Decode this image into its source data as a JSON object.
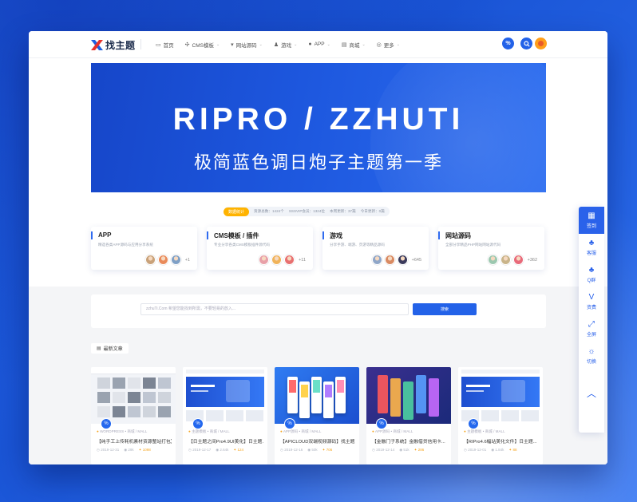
{
  "header": {
    "logo_text": "找主题",
    "nav": [
      {
        "icon": "monitor-icon",
        "glyph": "▭",
        "label": "首页",
        "caret": false
      },
      {
        "icon": "grid-icon",
        "glyph": "✣",
        "label": "CMS模板",
        "caret": true
      },
      {
        "icon": "vue-icon",
        "glyph": "▾",
        "label": "网站源码",
        "caret": true
      },
      {
        "icon": "game-icon",
        "glyph": "♟",
        "label": "游戏",
        "caret": true
      },
      {
        "icon": "apple-icon",
        "glyph": "●",
        "label": "APP",
        "caret": true
      },
      {
        "icon": "shop-icon",
        "glyph": "▤",
        "label": "商城",
        "caret": true
      },
      {
        "icon": "more-icon",
        "glyph": "◎",
        "label": "更多",
        "caret": true
      }
    ]
  },
  "banner": {
    "title": "RIPRO / ZZHUTI",
    "subtitle": "极简蓝色调日炮子主题第一季"
  },
  "stats": {
    "badge": "数据统计",
    "items": [
      "资源总数：1424个",
      "SSSVIP会员：1324位",
      "本周更新：37篇",
      "今日更新：0篇"
    ]
  },
  "categories": [
    {
      "title": "APP",
      "desc": "精选各类APP源码与应用分享系统",
      "count": "+1",
      "avatars": [
        "#c9a27a",
        "#e98a5a",
        "#7fa0c6"
      ]
    },
    {
      "title": "CMS模板 / 插件",
      "desc": "专业分享各类CMS模板插件源代码",
      "count": "+11",
      "avatars": [
        "#e8a0a8",
        "#f0b35a",
        "#e87070"
      ]
    },
    {
      "title": "游戏",
      "desc": "分享手游、端游、页游等精品源码",
      "count": "+645",
      "avatars": [
        "#8fa6c8",
        "#d98a62",
        "#3b3b5c"
      ]
    },
    {
      "title": "网站源码",
      "desc": "全部分享精品PHP网站网站源代码",
      "count": "+362",
      "avatars": [
        "#9cc8b0",
        "#c9b48a",
        "#e86a7a"
      ]
    }
  ],
  "search": {
    "placeholder": "zzhuTi.Com 希望您能找到所需，不要轻易的放入...",
    "button": "搜索"
  },
  "latest_label": "最新文章",
  "posts": [
    {
      "cat": "WORDPRESS",
      "cat2": " • 商城 / MALL",
      "title": "【纯手工上传耗机素材资源整站打包】",
      "date": "2019-12-31",
      "views": "29k",
      "hot": "1098",
      "theme": "gallery"
    },
    {
      "cat": "主题模板",
      "cat2": " • 商城 / MALL",
      "title": "【日主题之间Pro4.9UI美化】日主题...",
      "date": "2019-12-17",
      "views": "2.64k",
      "hot": "124",
      "theme": "web"
    },
    {
      "cat": "APP源码",
      "cat2": " • 商城 / MALL",
      "title": "【APICLOUD双端视频源码】找主题...",
      "date": "2019-12-16",
      "views": "50k",
      "hot": "706",
      "theme": "phones"
    },
    {
      "cat": "APP源码",
      "cat2": " • 商城 / MALL",
      "title": "【金融门子系统】金融借贷信用卡...",
      "date": "2019-12-14",
      "views": "51k",
      "hot": "286",
      "theme": "finance"
    },
    {
      "cat": "主题模板",
      "cat2": " • 商城 / MALL",
      "title": "【RIPro4.6幅站美化文件】日主题...",
      "date": "2019-12-01",
      "views": "1.84k",
      "hot": "88",
      "theme": "web2"
    }
  ],
  "sidebar": [
    {
      "icon": "calendar-icon",
      "glyph": "▦",
      "label": "签到"
    },
    {
      "icon": "qq-icon",
      "glyph": "♣",
      "label": "客服"
    },
    {
      "icon": "group-icon",
      "glyph": "♣",
      "label": "Q群"
    },
    {
      "icon": "vip-icon",
      "glyph": "V",
      "label": "资费"
    },
    {
      "icon": "fullscreen-icon",
      "glyph": "⤢",
      "label": "全屏"
    },
    {
      "icon": "sun-icon",
      "glyph": "☼",
      "label": "切换"
    }
  ],
  "colors": {
    "brand": "#2362e8",
    "accent": "#f5a623"
  }
}
